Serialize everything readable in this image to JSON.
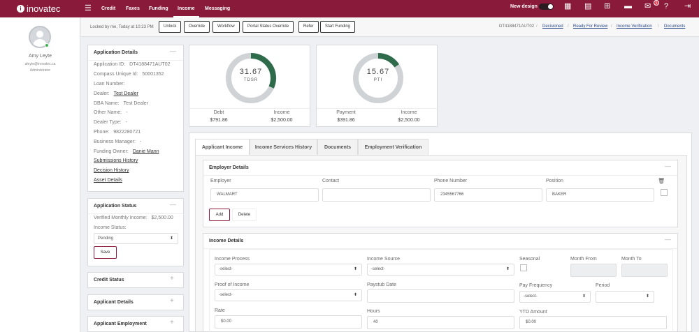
{
  "brand": {
    "name": "inovatec",
    "mark": "i"
  },
  "nav": {
    "items": [
      "Credit",
      "Faxes",
      "Funding",
      "Income",
      "Messaging"
    ],
    "active": "Income"
  },
  "topbar": {
    "new_design_label": "New design",
    "notifications_count": "5"
  },
  "user": {
    "name": "Amy Leyte",
    "email": "aleyte@inovatec.ca",
    "role": "Administrator"
  },
  "actionbar": {
    "locked_text": "Locked by me, Today at 10:23 PM",
    "buttons": [
      "Unlock",
      "Override",
      "Workflow",
      "Portal Status Override",
      "Refer",
      "Start Funding"
    ],
    "app_id": "DT4188471AUT02",
    "breadcrumbs": [
      "Decisioned",
      "Ready For Review",
      "Income Verification",
      "Documents"
    ]
  },
  "application_details": {
    "title": "Application Details",
    "fields": [
      {
        "label": "Application ID:",
        "value": "DT4188471AUT02"
      },
      {
        "label": "Compass Unique Id:",
        "value": "50001352"
      },
      {
        "label": "Loan Number:",
        "value": ""
      },
      {
        "label": "Dealer:",
        "value": "Test Dealer"
      },
      {
        "label": "DBA Name:",
        "value": "Test Dealer"
      },
      {
        "label": "Other Name:",
        "value": "-"
      },
      {
        "label": "Dealer Type:",
        "value": "-"
      },
      {
        "label": "Phone:",
        "value": "9822280721"
      },
      {
        "label": "Business Manager:",
        "value": "-"
      },
      {
        "label": "Funding Owner:",
        "value": "Danie Mann"
      }
    ],
    "links": [
      "Submissions History",
      "Decision History",
      "Asset Details"
    ]
  },
  "application_status": {
    "title": "Application Status",
    "verified_income_label": "Verified Monthly Income:",
    "verified_income_value": "$2,500.00",
    "income_status_label": "Income Status:",
    "income_status_value": "Pending",
    "save_label": "Save"
  },
  "collapsed_cards": [
    "Credit Status",
    "Applicant Details",
    "Applicant Employment"
  ],
  "ratios": [
    {
      "value": "31.67",
      "name": "TDSR",
      "fraction": 0.3167,
      "left_label": "Debt",
      "left_value": "$791.86",
      "right_label": "Income",
      "right_value": "$2,500.00"
    },
    {
      "value": "15.67",
      "name": "PTI",
      "fraction": 0.1567,
      "left_label": "Payment",
      "left_value": "$391.86",
      "right_label": "Income",
      "right_value": "$2,500.00"
    }
  ],
  "tabs": [
    "Applicant Income",
    "Income Services History",
    "Documents",
    "Employment Verification"
  ],
  "employer": {
    "title": "Employer Details",
    "labels": [
      "Employer",
      "Contact",
      "Phone Number",
      "Position"
    ],
    "values": [
      "WALMART",
      "",
      "2345567766",
      "BAKER"
    ],
    "add_label": "Add",
    "delete_label": "Delete"
  },
  "income": {
    "title": "Income Details",
    "income_process_label": "Income Process",
    "income_process_value": "-select-",
    "income_source_label": "Income Source",
    "income_source_value": "-select-",
    "seasonal_label": "Seasonal",
    "month_from_label": "Month From",
    "month_to_label": "Month To",
    "proof_label": "Proof of Income",
    "proof_value": "-select-",
    "paystub_label": "Paystub Date",
    "pay_frequency_label": "Pay Frequency",
    "pay_frequency_value": "-select-",
    "period_label": "Period",
    "rate_label": "Rate",
    "rate_value": "$0.00",
    "hours_label": "Hours",
    "hours_value": "40",
    "ytd_label": "YTD Amount",
    "ytd_value": "$0.00"
  },
  "colors": {
    "brand": "#8a1a3a",
    "gauge_fill": "#2e6b4a",
    "gauge_track": "#d0d3d6"
  }
}
